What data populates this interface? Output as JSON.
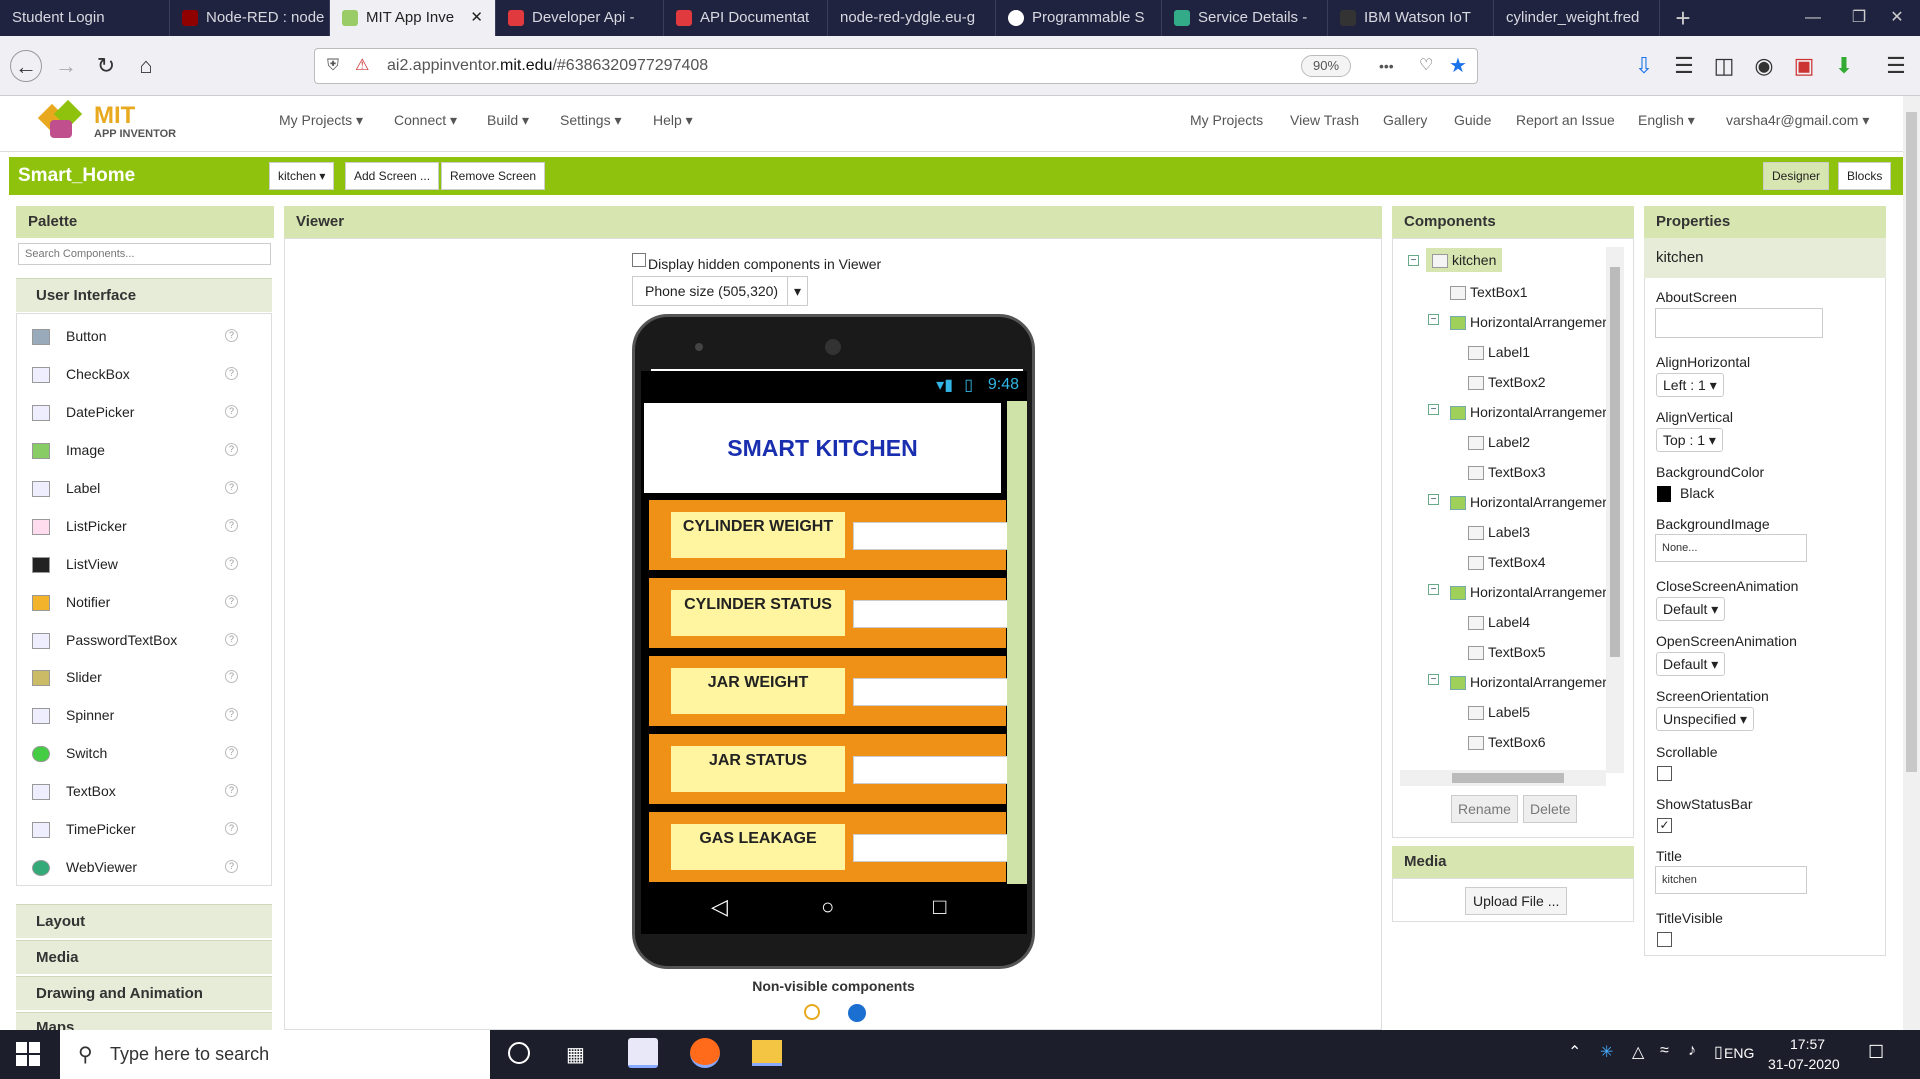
{
  "browser": {
    "tabs": [
      {
        "label": "Student Login",
        "color": ""
      },
      {
        "label": "Node-RED : node",
        "color": "#8f0000"
      },
      {
        "label": "MIT App Inve",
        "color": "#9c6"
      },
      {
        "label": "Developer Api -",
        "color": "#e03a3e"
      },
      {
        "label": "API Documentat",
        "color": "#e03a3e"
      },
      {
        "label": "node-red-ydgle.eu-g",
        "color": ""
      },
      {
        "label": "Programmable S",
        "color": "#fff"
      },
      {
        "label": "Service Details -",
        "color": "#3a8"
      },
      {
        "label": "IBM Watson IoT",
        "color": "#333"
      },
      {
        "label": "cylinder_weight.fred",
        "color": ""
      }
    ],
    "new_tab": "+",
    "close_tab": "✕",
    "url_prefix": "ai2.appinventor.",
    "url_domain": "mit.edu",
    "url_rest": "/#6386320977297408",
    "zoom": "90%",
    "more": "•••",
    "win_min": "—",
    "win_max": "❐",
    "win_close": "✕"
  },
  "app": {
    "logo_title": "MIT",
    "logo_sub": "APP INVENTOR",
    "menus_left": [
      "My Projects",
      "Connect",
      "Build",
      "Settings",
      "Help"
    ],
    "menus_right": [
      "My Projects",
      "View Trash",
      "Gallery",
      "Guide",
      "Report an Issue",
      "English",
      "varsha4r@gmail.com"
    ],
    "project_name": "Smart_Home",
    "screen_select": "kitchen",
    "add_screen": "Add Screen ...",
    "remove_screen": "Remove Screen",
    "designer": "Designer",
    "blocks": "Blocks"
  },
  "palette": {
    "title": "Palette",
    "search_placeholder": "Search Components...",
    "section": "User Interface",
    "items": [
      "Button",
      "CheckBox",
      "DatePicker",
      "Image",
      "Label",
      "ListPicker",
      "ListView",
      "Notifier",
      "PasswordTextBox",
      "Slider",
      "Spinner",
      "Switch",
      "TextBox",
      "TimePicker",
      "WebViewer"
    ],
    "help": "?",
    "drawers": [
      "Layout",
      "Media",
      "Drawing and Animation",
      "Maps"
    ]
  },
  "viewer": {
    "title": "Viewer",
    "hidden_label": "Display hidden components in Viewer",
    "phone_size": "Phone size (505,320)",
    "time": "9:48",
    "screen_title": "SMART KITCHEN",
    "rows": [
      "CYLINDER WEIGHT",
      "CYLINDER STATUS",
      "JAR WEIGHT",
      "JAR STATUS",
      "GAS LEAKAGE"
    ],
    "nonvisible": "Non-visible components",
    "colors": {
      "title_text": "#1a2fb0",
      "row_bg": "#f09117",
      "label_bg": "#fff4a0",
      "scrollbar": "#cfe3a8"
    }
  },
  "components": {
    "title": "Components",
    "tree": [
      {
        "label": "kitchen",
        "depth": 0,
        "type": "screen"
      },
      {
        "label": "TextBox1",
        "depth": 1,
        "type": "textbox"
      },
      {
        "label": "HorizontalArrangemer",
        "depth": 1,
        "type": "arr"
      },
      {
        "label": "Label1",
        "depth": 2,
        "type": "label"
      },
      {
        "label": "TextBox2",
        "depth": 2,
        "type": "textbox"
      },
      {
        "label": "HorizontalArrangemer",
        "depth": 1,
        "type": "arr"
      },
      {
        "label": "Label2",
        "depth": 2,
        "type": "label"
      },
      {
        "label": "TextBox3",
        "depth": 2,
        "type": "textbox"
      },
      {
        "label": "HorizontalArrangemer",
        "depth": 1,
        "type": "arr"
      },
      {
        "label": "Label3",
        "depth": 2,
        "type": "label"
      },
      {
        "label": "TextBox4",
        "depth": 2,
        "type": "textbox"
      },
      {
        "label": "HorizontalArrangemer",
        "depth": 1,
        "type": "arr"
      },
      {
        "label": "Label4",
        "depth": 2,
        "type": "label"
      },
      {
        "label": "TextBox5",
        "depth": 2,
        "type": "textbox"
      },
      {
        "label": "HorizontalArrangemer",
        "depth": 1,
        "type": "arr"
      },
      {
        "label": "Label5",
        "depth": 2,
        "type": "label"
      },
      {
        "label": "TextBox6",
        "depth": 2,
        "type": "textbox"
      }
    ],
    "rename": "Rename",
    "delete": "Delete"
  },
  "media": {
    "title": "Media",
    "upload": "Upload File ..."
  },
  "properties": {
    "title": "Properties",
    "component": "kitchen",
    "about_label": "AboutScreen",
    "align_h_label": "AlignHorizontal",
    "align_h_value": "Left : 1",
    "align_v_label": "AlignVertical",
    "align_v_value": "Top : 1",
    "bgcolor_label": "BackgroundColor",
    "bgcolor_value": "Black",
    "bgimage_label": "BackgroundImage",
    "bgimage_value": "None...",
    "close_anim_label": "CloseScreenAnimation",
    "close_anim_value": "Default",
    "open_anim_label": "OpenScreenAnimation",
    "open_anim_value": "Default",
    "orientation_label": "ScreenOrientation",
    "orientation_value": "Unspecified",
    "scrollable_label": "Scrollable",
    "scrollable": false,
    "statusbar_label": "ShowStatusBar",
    "statusbar": true,
    "title_label": "Title",
    "title_value": "kitchen",
    "titlevisible_label": "TitleVisible",
    "titlevisible": false
  },
  "taskbar": {
    "search": "Type here to search",
    "lang": "ENG",
    "time": "17:57",
    "date": "31-07-2020"
  }
}
